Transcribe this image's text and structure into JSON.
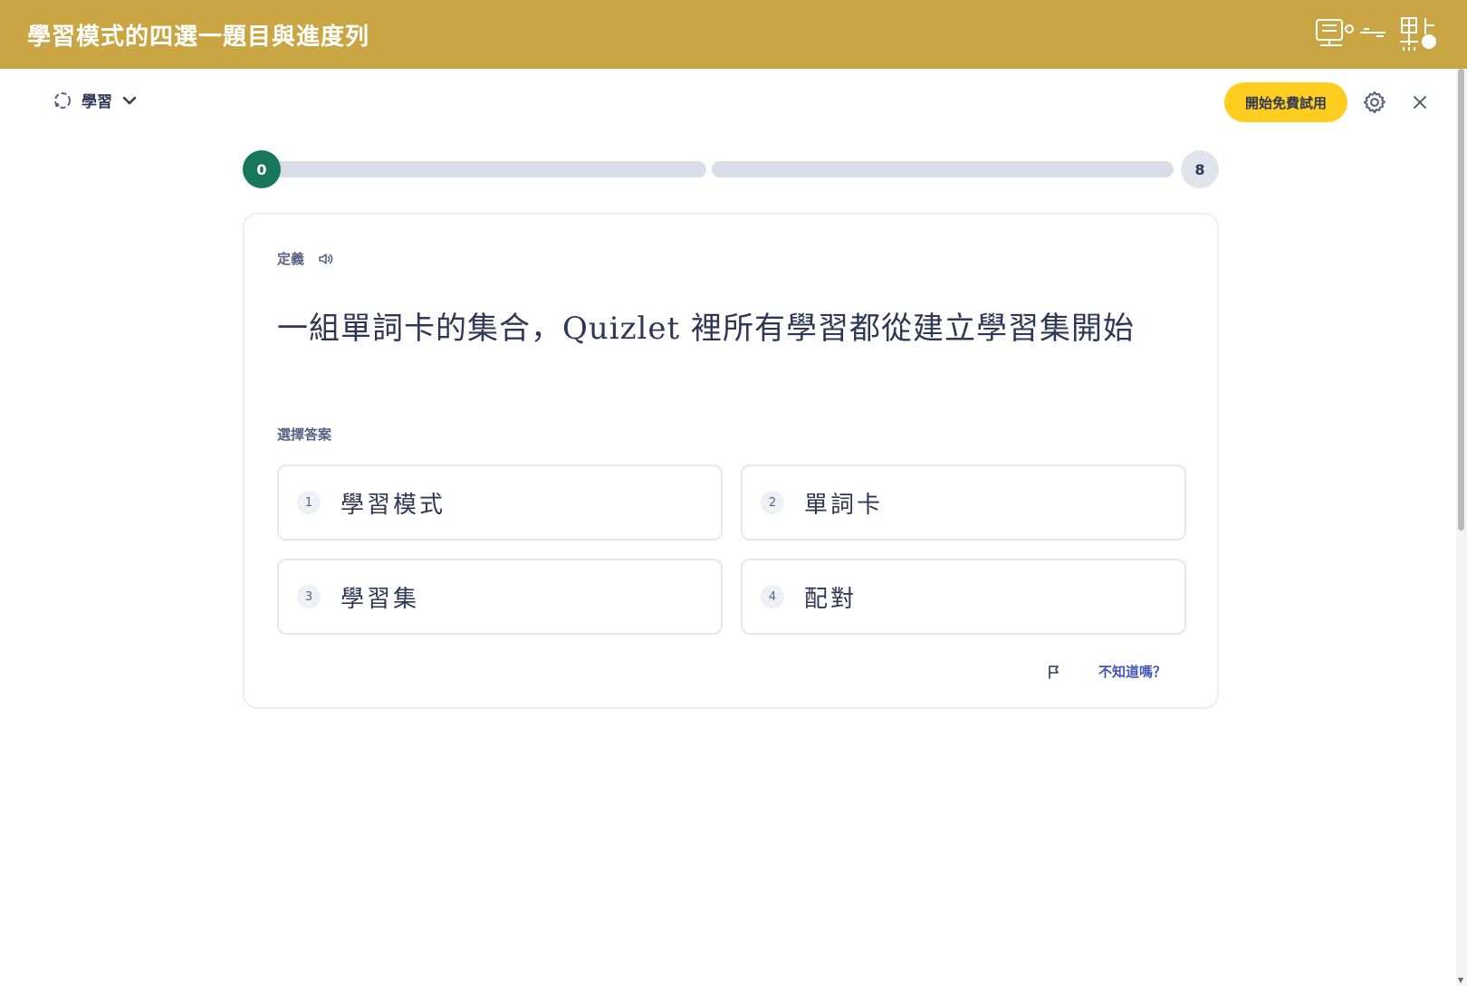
{
  "banner": {
    "title": "學習模式的四選一題目與進度列",
    "logo_icon": "learn-logo-icon"
  },
  "header": {
    "mode_label": "學習",
    "mode_icon": "learn-mode-icon",
    "dropdown_icon": "chevron-down-icon",
    "trial_button": "開始免費試用",
    "settings_icon": "gear-icon",
    "close_icon": "close-icon"
  },
  "progress": {
    "start": "0",
    "end": "8",
    "fraction": 0,
    "accent": "#18775b"
  },
  "question": {
    "section_label": "定義",
    "audio_icon": "speaker-icon",
    "text": "一組單詞卡的集合，Quizlet 裡所有學習都從建立學習集開始",
    "choose_label": "選擇答案",
    "options": [
      {
        "number": "1",
        "text": "學習模式"
      },
      {
        "number": "2",
        "text": "單詞卡"
      },
      {
        "number": "3",
        "text": "學習集"
      },
      {
        "number": "4",
        "text": "配對"
      }
    ],
    "flag_icon": "flag-icon",
    "dont_know": "不知道嗎？"
  },
  "colors": {
    "banner": "#caa543",
    "trial_button": "#ffcd1f",
    "link": "#4257b2",
    "text": "#2e3856"
  }
}
